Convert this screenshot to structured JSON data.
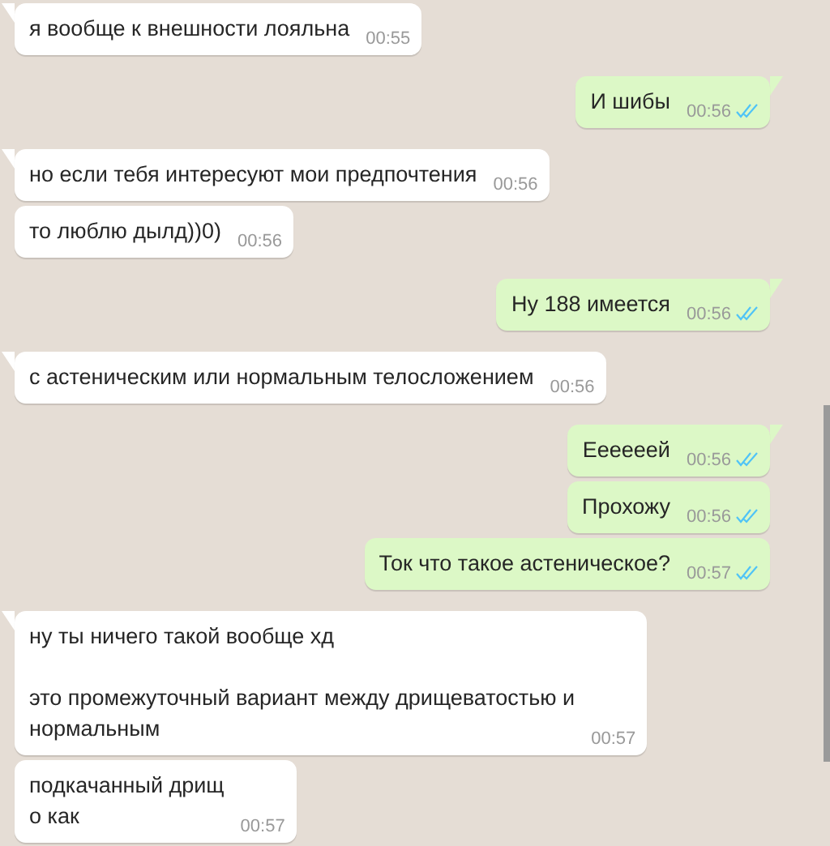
{
  "messages": [
    {
      "outgoing": false,
      "text": "я вообще к внешности лояльна",
      "time": "00:55"
    },
    {
      "outgoing": true,
      "text": "И шибы",
      "time": "00:56",
      "read": true
    },
    {
      "outgoing": false,
      "text": "но если тебя интересуют мои предпочтения",
      "time": "00:56"
    },
    {
      "outgoing": false,
      "text": "то люблю дылд))0)",
      "time": "00:56"
    },
    {
      "outgoing": true,
      "text": "Ну 188 имеется",
      "time": "00:56",
      "read": true
    },
    {
      "outgoing": false,
      "text": "с астеническим или нормальным телосложением",
      "time": "00:56"
    },
    {
      "outgoing": true,
      "text": "Еееееей",
      "time": "00:56",
      "read": true
    },
    {
      "outgoing": true,
      "text": "Прохожу",
      "time": "00:56",
      "read": true
    },
    {
      "outgoing": true,
      "text": "Ток что такое астеническое?",
      "time": "00:57",
      "read": true
    },
    {
      "outgoing": false,
      "text": "ну ты ничего такой вообще хд\n\nэто промежуточный вариант между дрищеватостью и\nнормальным",
      "time": "00:57"
    },
    {
      "outgoing": false,
      "text": "подкачанный дрищ\nо как",
      "time": "00:57"
    }
  ]
}
